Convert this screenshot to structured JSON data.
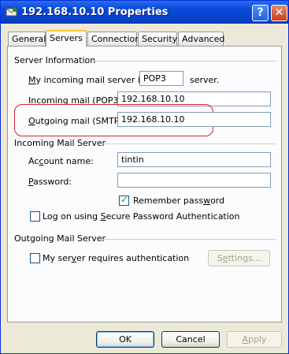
{
  "window": {
    "title": "192.168.10.10 Properties"
  },
  "titlebar": {
    "help_label": "?",
    "close_label": "✕"
  },
  "tabs": [
    {
      "label": "General"
    },
    {
      "label": "Servers"
    },
    {
      "label": "Connection"
    },
    {
      "label": "Security"
    },
    {
      "label": "Advanced"
    }
  ],
  "server_info": {
    "group_label": "Server Information",
    "incoming_type_prefix_u": "M",
    "incoming_type_prefix_rest": "y incoming mail server is a",
    "incoming_type_value": "POP3",
    "incoming_type_suffix": "server.",
    "incoming_label_u": "I",
    "incoming_label_rest": "ncoming mail (POP3):",
    "incoming_value": "192.168.10.10",
    "outgoing_label_u": "O",
    "outgoing_label_rest": "utgoing mail (SMTP):",
    "outgoing_value": "192.168.10.10"
  },
  "incoming_server": {
    "group_label": "Incoming Mail Server",
    "account_label_pre": "Ac",
    "account_label_u": "c",
    "account_label_rest": "ount name:",
    "account_value": "tintin",
    "password_label_u": "P",
    "password_label_rest": "assword:",
    "password_value": "",
    "remember_pre": "Remember pass",
    "remember_u": "w",
    "remember_rest": "ord",
    "remember_checked": true,
    "spa_pre": "Log on using ",
    "spa_u": "S",
    "spa_rest": "ecure Password Authentication",
    "spa_checked": false
  },
  "outgoing_server": {
    "group_label": "Outgoing Mail Server",
    "auth_pre": "My ser",
    "auth_u": "v",
    "auth_rest": "er requires authentication",
    "auth_checked": false,
    "settings_pre": "S",
    "settings_u": "e",
    "settings_rest": "ttings..."
  },
  "footer": {
    "ok_label": "OK",
    "cancel_label": "Cancel",
    "apply_u": "A",
    "apply_rest": "pply"
  }
}
